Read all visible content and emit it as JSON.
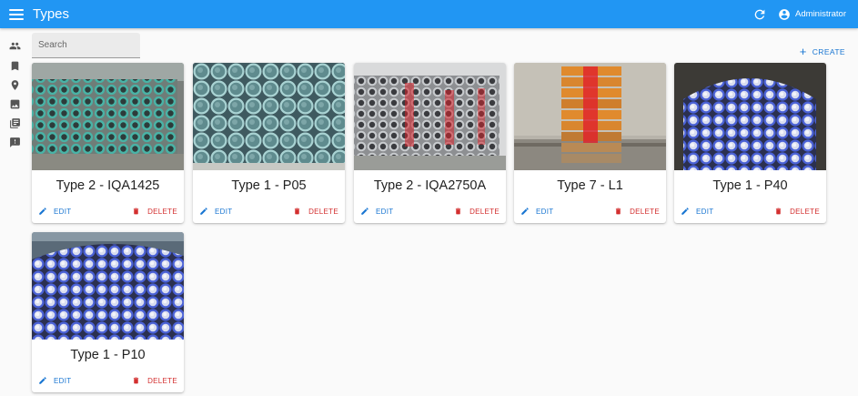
{
  "appbar": {
    "title": "Types",
    "menu_icon": "hamburger-menu-icon",
    "refresh_icon": "refresh-icon",
    "user_icon": "account-circle-icon",
    "user_name": "Administrator",
    "color": "#2196f3"
  },
  "sidebar": {
    "items": [
      {
        "icon": "people-icon"
      },
      {
        "icon": "bookmark-icon"
      },
      {
        "icon": "location-pin-icon"
      },
      {
        "icon": "image-icon"
      },
      {
        "icon": "library-books-icon"
      },
      {
        "icon": "feedback-icon"
      }
    ]
  },
  "search": {
    "placeholder": "Search",
    "value": ""
  },
  "toolbar": {
    "create_label": "CREATE",
    "create_icon": "plus-icon"
  },
  "actions": {
    "edit_label": "EDIT",
    "delete_label": "DELETE",
    "edit_icon": "pencil-icon",
    "delete_icon": "trash-icon"
  },
  "colors": {
    "primary": "#1976d2",
    "danger": "#d32f2f"
  },
  "cards": [
    {
      "name": "Type 2 - IQA1425",
      "photo": "teal-pipes-photo"
    },
    {
      "name": "Type 1 - P05",
      "photo": "light-blue-pipes-photo"
    },
    {
      "name": "Type 2 - IQA2750A",
      "photo": "grey-red-pipes-photo"
    },
    {
      "name": "Type 7 - L1",
      "photo": "orange-red-profiles-photo"
    },
    {
      "name": "Type 1 - P40",
      "photo": "blue-pipes-photo"
    },
    {
      "name": "Type 1 - P10",
      "photo": "blue-pipes-photo"
    }
  ]
}
